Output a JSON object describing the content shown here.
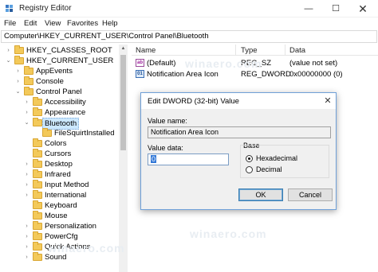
{
  "window": {
    "title": "Registry Editor",
    "controls": {
      "minimize": "—",
      "maximize": "☐",
      "close": "✕"
    }
  },
  "menu": {
    "items": [
      "File",
      "Edit",
      "View",
      "Favorites",
      "Help"
    ]
  },
  "address": {
    "path": "Computer\\HKEY_CURRENT_USER\\Control Panel\\Bluetooth"
  },
  "tree": {
    "items": [
      {
        "label": "HKEY_CLASSES_ROOT",
        "expander": "›",
        "depth": 0
      },
      {
        "label": "HKEY_CURRENT_USER",
        "expander": "⌄",
        "depth": 0
      },
      {
        "label": "AppEvents",
        "expander": "›",
        "depth": 1
      },
      {
        "label": "Console",
        "expander": "›",
        "depth": 1
      },
      {
        "label": "Control Panel",
        "expander": "⌄",
        "depth": 1
      },
      {
        "label": "Accessibility",
        "expander": "›",
        "depth": 2
      },
      {
        "label": "Appearance",
        "expander": "›",
        "depth": 2
      },
      {
        "label": "Bluetooth",
        "expander": "⌄",
        "depth": 2,
        "selected": true
      },
      {
        "label": "FileSquirtInstalled",
        "expander": "",
        "depth": 3
      },
      {
        "label": "Colors",
        "expander": "",
        "depth": 2
      },
      {
        "label": "Cursors",
        "expander": "",
        "depth": 2
      },
      {
        "label": "Desktop",
        "expander": "›",
        "depth": 2
      },
      {
        "label": "Infrared",
        "expander": "›",
        "depth": 2
      },
      {
        "label": "Input Method",
        "expander": "›",
        "depth": 2
      },
      {
        "label": "International",
        "expander": "›",
        "depth": 2
      },
      {
        "label": "Keyboard",
        "expander": "",
        "depth": 2
      },
      {
        "label": "Mouse",
        "expander": "",
        "depth": 2
      },
      {
        "label": "Personalization",
        "expander": "›",
        "depth": 2
      },
      {
        "label": "PowerCfg",
        "expander": "›",
        "depth": 2
      },
      {
        "label": "Quick Actions",
        "expander": "›",
        "depth": 2
      },
      {
        "label": "Sound",
        "expander": "›",
        "depth": 2
      }
    ]
  },
  "list": {
    "columns": [
      "Name",
      "Type",
      "Data"
    ],
    "rows": [
      {
        "icon": "string-value-icon",
        "icon_glyph": "ab",
        "name": "(Default)",
        "type": "REG_SZ",
        "data": "(value not set)"
      },
      {
        "icon": "dword-value-icon",
        "icon_glyph": "01",
        "name": "Notification Area Icon",
        "type": "REG_DWORD",
        "data": "0x00000000 (0)"
      }
    ]
  },
  "dialog": {
    "title": "Edit DWORD (32-bit) Value",
    "close_glyph": "✕",
    "value_name_label": "Value name:",
    "value_name": "Notification Area Icon",
    "value_data_label": "Value data:",
    "value_data": "0",
    "base_label": "Base",
    "hex_label": "Hexadecimal",
    "dec_label": "Decimal",
    "base_selected": "Hexadecimal",
    "ok_label": "OK",
    "cancel_label": "Cancel"
  },
  "watermark": {
    "text": "winaero.com"
  },
  "colors": {
    "selection": "#cce8ff",
    "folder": "#f3c95a",
    "accent": "#3278d7"
  }
}
